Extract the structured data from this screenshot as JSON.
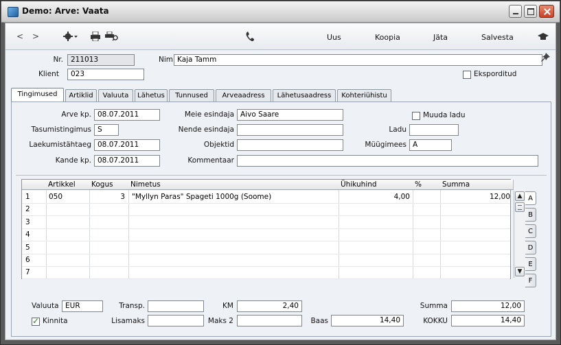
{
  "window": {
    "title": "Demo: Arve: Vaata"
  },
  "toolbar": {
    "new_label": "Uus",
    "copy_label": "Koopia",
    "skip_label": "Jäta",
    "save_label": "Salvesta"
  },
  "header": {
    "nr_label": "Nr.",
    "nr_value": "211013",
    "name_label": "Nimi",
    "name_value": "Kaja Tamm",
    "client_label": "Klient",
    "client_value": "023",
    "exported_label": "Eksporditud",
    "exported_checked": false
  },
  "tabs": [
    "Tingimused",
    "Artiklid",
    "Valuuta",
    "Lähetus",
    "Tunnused",
    "Arveaadress",
    "Lähetusaadress",
    "Kohteriühistu"
  ],
  "terms": {
    "invoice_date_label": "Arve kp.",
    "invoice_date": "08.07.2011",
    "payment_terms_label": "Tasumistingimus",
    "payment_terms": "S",
    "due_date_label": "Laekumistähtaeg",
    "due_date": "08.07.2011",
    "trans_date_label": "Kande kp.",
    "trans_date": "08.07.2011",
    "our_rep_label": "Meie esindaja",
    "our_rep": "Aivo Saare",
    "their_rep_label": "Nende esindaja",
    "their_rep": "",
    "objects_label": "Objektid",
    "objects": "",
    "comment_label": "Kommentaar",
    "comment": "",
    "change_stock_label": "Muuda ladu",
    "change_stock_checked": false,
    "stock_label": "Ladu",
    "stock": "",
    "salesman_label": "Müügimees",
    "salesman": "A"
  },
  "grid": {
    "columns": [
      "Artikkel",
      "Kogus",
      "Nimetus",
      "Ühikuhind",
      "%",
      "Summa"
    ],
    "rows": [
      {
        "num": "1",
        "item": "050",
        "qty": "3",
        "name": "\"Myllyn Paras\" Spageti 1000g  (Soome)",
        "price": "4,00",
        "pct": "",
        "sum": "12,00"
      },
      {
        "num": "2",
        "item": "",
        "qty": "",
        "name": "",
        "price": "",
        "pct": "",
        "sum": ""
      },
      {
        "num": "3",
        "item": "",
        "qty": "",
        "name": "",
        "price": "",
        "pct": "",
        "sum": ""
      },
      {
        "num": "4",
        "item": "",
        "qty": "",
        "name": "",
        "price": "",
        "pct": "",
        "sum": ""
      },
      {
        "num": "5",
        "item": "",
        "qty": "",
        "name": "",
        "price": "",
        "pct": "",
        "sum": ""
      },
      {
        "num": "6",
        "item": "",
        "qty": "",
        "name": "",
        "price": "",
        "pct": "",
        "sum": ""
      },
      {
        "num": "7",
        "item": "",
        "qty": "",
        "name": "",
        "price": "",
        "pct": "",
        "sum": ""
      }
    ],
    "row_tabs": [
      "A",
      "B",
      "C",
      "D",
      "E",
      "F"
    ]
  },
  "footer": {
    "currency_label": "Valuuta",
    "currency": "EUR",
    "transp_label": "Transp.",
    "transp": "",
    "vat_label": "KM",
    "vat": "2,40",
    "sum_label": "Summa",
    "sum": "12,00",
    "approve_label": "Kinnita",
    "approve_checked": true,
    "surcharge_label": "Lisamaks",
    "surcharge": "",
    "tax2_label": "Maks 2",
    "tax2": "",
    "base_label": "Baas",
    "base": "14,40",
    "total_label": "KOKKU",
    "total": "14,40"
  }
}
